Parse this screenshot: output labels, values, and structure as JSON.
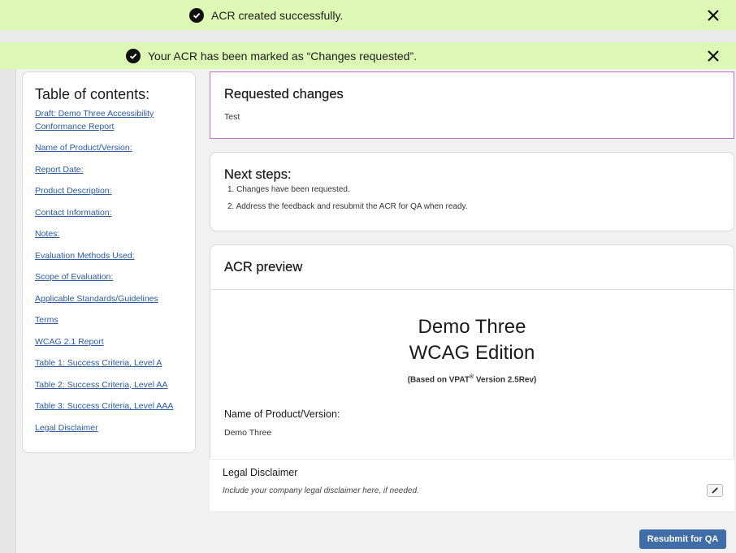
{
  "banners": [
    {
      "message": "ACR created successfully."
    },
    {
      "message": "Your ACR has been marked as “Changes requested”."
    }
  ],
  "toc": {
    "title": "Table of contents:",
    "items": [
      "Draft: Demo Three Accessibility Conformance Report",
      "Name of Product/Version:",
      "Report Date:",
      "Product Description:",
      "Contact Information:",
      "Notes:",
      "Evaluation Methods Used:",
      "Scope of Evaluation:",
      "Applicable Standards/Guidelines",
      "Terms",
      "WCAG 2.1 Report",
      "Table 1: Success Criteria, Level A",
      "Table 2: Success Criteria, Level AA",
      "Table 3: Success Criteria, Level AAA",
      "Legal Disclaimer"
    ]
  },
  "requested_changes": {
    "title": "Requested changes",
    "text": "Test"
  },
  "next_steps": {
    "title": "Next steps:",
    "items": [
      "1. Changes have been requested.",
      "2. Address the feedback and resubmit the ACR for QA when ready."
    ]
  },
  "preview": {
    "title": "ACR preview",
    "doc_title_line1": "Demo Three",
    "doc_title_line2": "WCAG Edition",
    "based_on_prefix": "(Based on VPAT",
    "based_on_sup": "®",
    "based_on_suffix": " Version 2.5Rev)",
    "product_label": "Name of Product/Version:",
    "product_value": "Demo Three"
  },
  "legal": {
    "title": "Legal Disclaimer",
    "placeholder": "Include your company legal disclaimer here, if needed."
  },
  "actions": {
    "resubmit_label": "Resubmit for QA"
  },
  "icons": {
    "banner_status": "check-circle-icon",
    "banner_close": "close-icon",
    "edit": "pencil-icon"
  },
  "colors": {
    "banner_bg": "#ddf7b4",
    "link": "#2a5aa0",
    "requested_border": "#c86ed0",
    "primary_button": "#3f6da8"
  }
}
